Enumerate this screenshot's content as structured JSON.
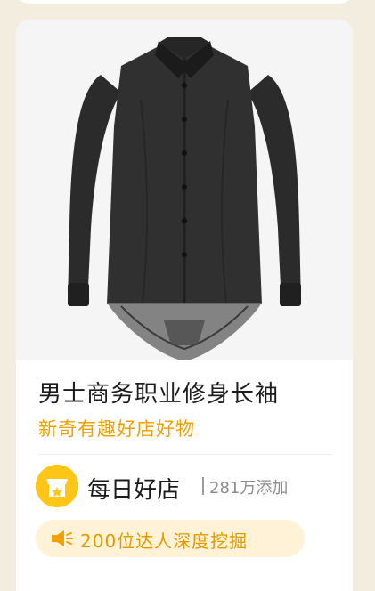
{
  "product": {
    "title": "男士商务职业修身长袖",
    "subtitle": "新奇有趣好店好物"
  },
  "shop": {
    "name": "每日好店",
    "stat": "281万添加"
  },
  "badge": {
    "text": "200位达人深度挖掘"
  },
  "colors": {
    "accent": "#f0a100",
    "badge_bg": "#fff2d6",
    "logo_bg": "#ffc517"
  }
}
